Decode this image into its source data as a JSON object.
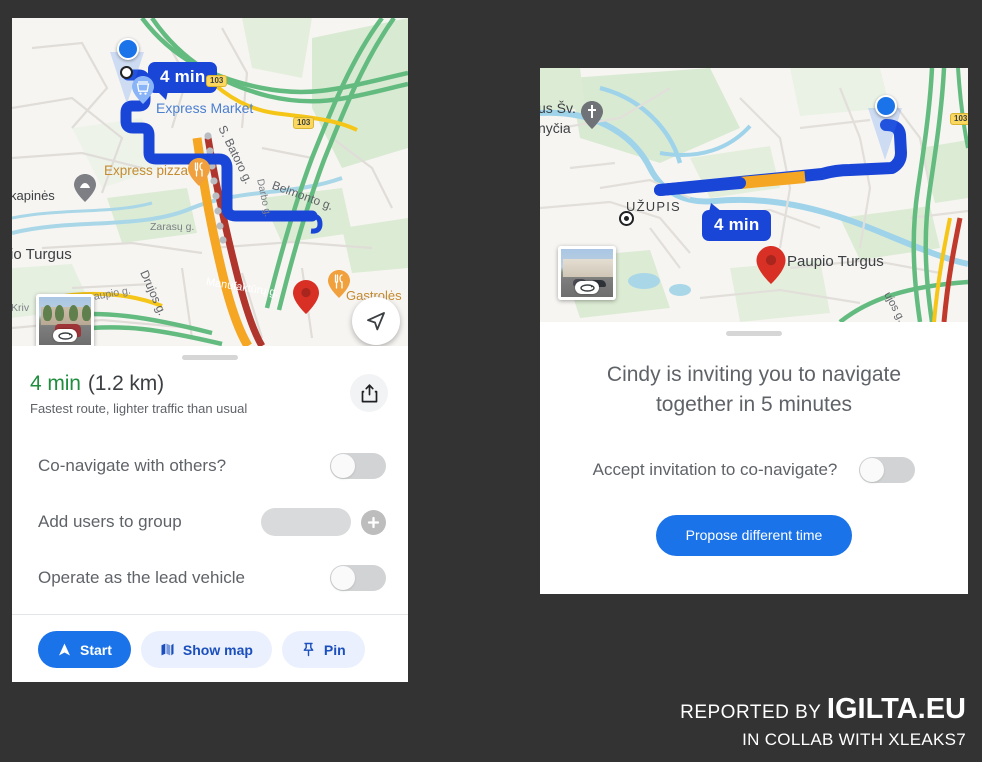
{
  "background_color": "#333333",
  "left_phone": {
    "map": {
      "eta_badge": "4 min",
      "labels": [
        {
          "text": "Express Market",
          "color": "#4a7fd1"
        },
        {
          "text": "Express pizza",
          "color": "#c58b2f"
        },
        {
          "text": "kapinės",
          "color": "#3c4043"
        },
        {
          "text": "Zarasų g.",
          "color": "#7b7f84"
        },
        {
          "text": "S. Batoro g.",
          "color": "#5f6368"
        },
        {
          "text": "Belmonto g.",
          "color": "#5f6368"
        },
        {
          "text": "Darbo g.",
          "color": "#7b7f84"
        },
        {
          "text": "io Turgus",
          "color": "#3c4043"
        },
        {
          "text": "Drujos g.",
          "color": "#5f6368"
        },
        {
          "text": "Manufaktūrų g.",
          "color": "#ffffff"
        },
        {
          "text": "paupio g.",
          "color": "#7b7f84"
        },
        {
          "text": "Kriv",
          "color": "#7b7f84"
        },
        {
          "text": "Gastrolės",
          "color": "#c58b2f"
        }
      ],
      "shields": [
        "103",
        "103"
      ],
      "streetview_label": "street-view-thumbnail"
    },
    "sheet": {
      "duration": "4 min",
      "distance": "(1.2 km)",
      "subtitle": "Fastest route, lighter traffic than usual",
      "share_icon": "share-icon",
      "options": [
        {
          "label": "Co-navigate  with others?",
          "control": "toggle",
          "state": "off"
        },
        {
          "label": "Add users to group",
          "control": "input",
          "value": "",
          "placeholder": ""
        },
        {
          "label": "Operate as the lead vehicle",
          "control": "toggle",
          "state": "off"
        }
      ],
      "actions": [
        {
          "label": "Start",
          "icon": "navigation-arrow-icon",
          "style": "primary"
        },
        {
          "label": "Show map",
          "icon": "map-icon",
          "style": "secondary"
        },
        {
          "label": "Pin",
          "icon": "pin-icon",
          "style": "secondary"
        }
      ]
    }
  },
  "right_phone": {
    "map": {
      "eta_badge": "4 min",
      "labels": [
        {
          "text": "us Šv.",
          "color": "#3c4043"
        },
        {
          "text": "nyčia",
          "color": "#3c4043"
        },
        {
          "text": "UŽUPIS",
          "color": "#3c4043"
        },
        {
          "text": "Paupio Turgus",
          "color": "#3c4043"
        },
        {
          "text": "ujos g.",
          "color": "#5f6368"
        }
      ],
      "shields": [
        "103"
      ],
      "streetview_label": "street-view-thumbnail"
    },
    "sheet": {
      "title": "Cindy is inviting you to navigate together in 5 minutes",
      "accept_label": "Accept invitation to co-navigate?",
      "accept_state": "off",
      "propose_button": "Propose different time"
    }
  },
  "watermark": {
    "prefix": "REPORTED BY",
    "brand": "IGILTA.EU",
    "collab": "IN COLLAB WITH XLEAKS7"
  }
}
